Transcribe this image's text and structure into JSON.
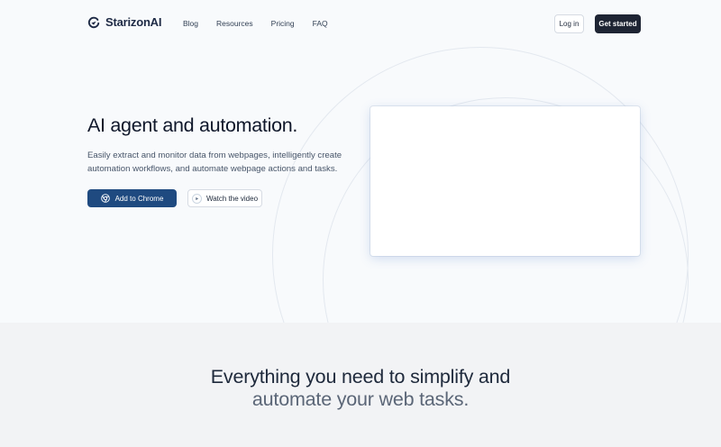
{
  "brand": {
    "name": "StarizonAI",
    "logo_icon": "starizon-logo-icon"
  },
  "nav": {
    "links": [
      {
        "label": "Blog"
      },
      {
        "label": "Resources"
      },
      {
        "label": "Pricing"
      },
      {
        "label": "FAQ"
      }
    ],
    "login_label": "Log in",
    "get_started_label": "Get started"
  },
  "hero": {
    "title": "AI agent and automation.",
    "description": "Easily extract and monitor data from webpages, intelligently create automation workflows, and automate webpage actions and tasks.",
    "primary_button": {
      "label": "Add to Chrome",
      "icon": "chrome-icon"
    },
    "secondary_button": {
      "label": "Watch the video",
      "icon": "play-icon"
    }
  },
  "features": {
    "title_line1": "Everything you need to simplify and",
    "title_line2": "automate your web tasks."
  },
  "colors": {
    "primary": "#1f4a80",
    "dark": "#1e2433",
    "background": "#f8fafc",
    "section_bg": "#f2f3f5"
  }
}
